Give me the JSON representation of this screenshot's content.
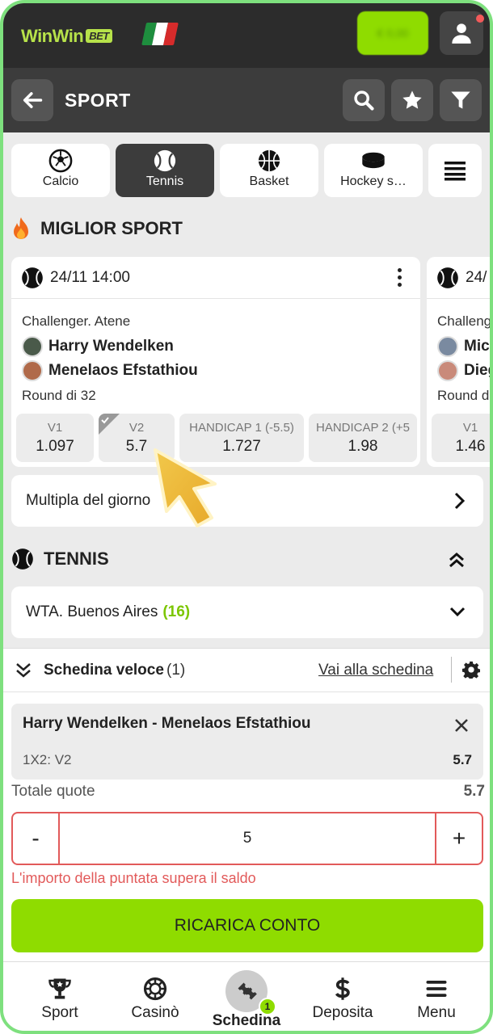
{
  "header": {
    "logo_main": "WinWin",
    "logo_bet": "BET",
    "balance": "€ 0,00"
  },
  "subheader": {
    "title": "SPORT"
  },
  "sport_tabs": [
    {
      "label": "Calcio",
      "icon": "soccer-ball-icon"
    },
    {
      "label": "Tennis",
      "icon": "tennis-ball-icon",
      "active": true
    },
    {
      "label": "Basket",
      "icon": "basketball-icon"
    },
    {
      "label": "Hockey s…",
      "icon": "hockey-puck-icon"
    }
  ],
  "top_sport": {
    "title": "MIGLIOR SPORT"
  },
  "events": [
    {
      "datetime": "24/11 14:00",
      "league": "Challenger. Atene",
      "player1": "Harry Wendelken",
      "player2": "Menelaos Efstathiou",
      "round": "Round di 32",
      "odds": [
        {
          "name": "V1",
          "value": "1.097"
        },
        {
          "name": "V2",
          "value": "5.7"
        },
        {
          "name": "HANDICAP 1 (-5.5)",
          "value": "1.727"
        },
        {
          "name": "HANDICAP 2 (+5",
          "value": "1.98"
        }
      ]
    },
    {
      "datetime": "24/",
      "league": "Challeng",
      "player1": "Mic",
      "player2": "Dieg",
      "round": "Round d",
      "odds": [
        {
          "name": "V1",
          "value": "1.46"
        }
      ]
    }
  ],
  "daily_multiple": {
    "label": "Multipla del giorno"
  },
  "tennis_section": {
    "title": "TENNIS"
  },
  "league_row": {
    "name": "WTA. Buenos Aires",
    "count": "(16)"
  },
  "bet_slip": {
    "title": "Schedina veloce",
    "count": "(1)",
    "go_link": "Vai alla schedina",
    "selection_title": "Harry Wendelken - Menelaos Efstathiou",
    "market": "1X2: V2",
    "odd": "5.7",
    "total_label": "Totale quote",
    "total_value": "5.7",
    "stake": "5",
    "minus": "-",
    "plus": "+",
    "error": "L'importo della puntata supera il saldo",
    "recharge_label": "RICARICA CONTO"
  },
  "bottom_nav": [
    {
      "label": "Sport",
      "icon": "trophy-icon"
    },
    {
      "label": "Casinò",
      "icon": "casino-chip-icon"
    },
    {
      "label": "Schedina",
      "icon": "ticket-icon",
      "badge": "1"
    },
    {
      "label": "Deposita",
      "icon": "dollar-icon"
    },
    {
      "label": "Menu",
      "icon": "hamburger-icon"
    }
  ],
  "colors": {
    "accent_green": "#8fdc00",
    "dark": "#2c2c2c",
    "error_red": "#e25a5a",
    "count_green": "#7cc600"
  }
}
